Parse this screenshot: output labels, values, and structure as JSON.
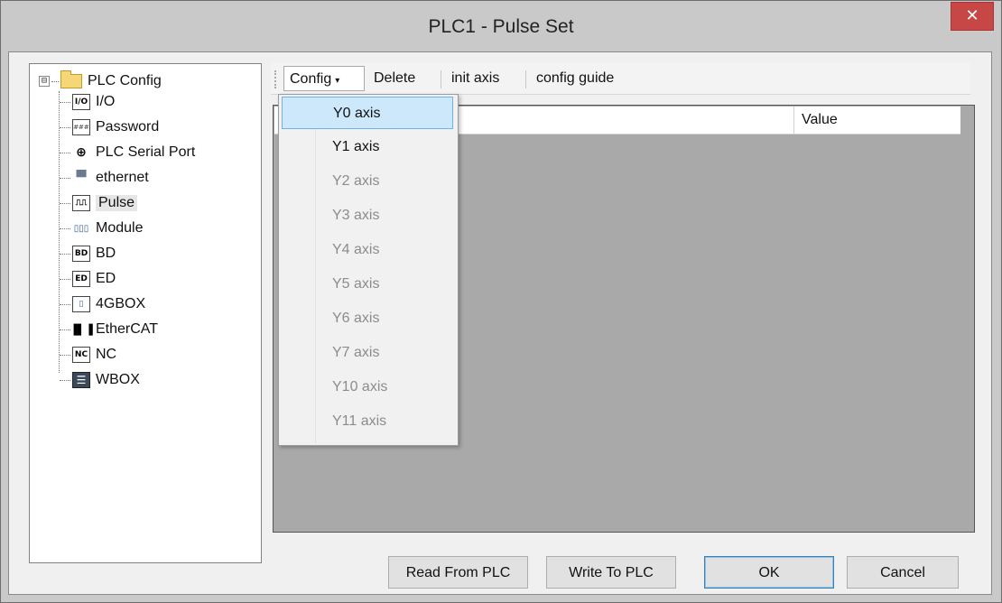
{
  "window": {
    "title": "PLC1 - Pulse  Set",
    "close_glyph": "✕"
  },
  "tree": {
    "root": {
      "label": "PLC Config",
      "expander": "⊟",
      "icon": "folder-icon"
    },
    "items": [
      {
        "label": "I/O",
        "icon": "io-icon",
        "glyph": "I/O"
      },
      {
        "label": "Password",
        "icon": "password-icon",
        "glyph": "###"
      },
      {
        "label": "PLC Serial Port",
        "icon": "serial-port-icon",
        "glyph": "⊕"
      },
      {
        "label": "ethernet",
        "icon": "ethernet-icon",
        "glyph": "▀"
      },
      {
        "label": "Pulse",
        "icon": "pulse-icon",
        "glyph": "⎍⎍",
        "selected": true
      },
      {
        "label": "Module",
        "icon": "module-icon",
        "glyph": "▯▯▯"
      },
      {
        "label": "BD",
        "icon": "bd-icon",
        "glyph": "BD"
      },
      {
        "label": "ED",
        "icon": "ed-icon",
        "glyph": "ED"
      },
      {
        "label": "4GBOX",
        "icon": "4gbox-icon",
        "glyph": "▯"
      },
      {
        "label": "EtherCAT",
        "icon": "ethercat-icon",
        "glyph": "▐▌▐"
      },
      {
        "label": "NC",
        "icon": "nc-icon",
        "glyph": "NC"
      },
      {
        "label": "WBOX",
        "icon": "wbox-icon",
        "glyph": "☰"
      }
    ]
  },
  "toolbar": {
    "config": "Config",
    "config_caret": "▾",
    "delete": "Delete",
    "init_axis": "init axis",
    "config_guide": "config guide"
  },
  "grid": {
    "columns": [
      "",
      "Value"
    ]
  },
  "dropdown": {
    "items": [
      {
        "label": "Y0 axis",
        "enabled": true,
        "highlighted": true
      },
      {
        "label": "Y1 axis",
        "enabled": true
      },
      {
        "label": "Y2 axis",
        "enabled": false
      },
      {
        "label": "Y3 axis",
        "enabled": false
      },
      {
        "label": "Y4 axis",
        "enabled": false
      },
      {
        "label": "Y5 axis",
        "enabled": false
      },
      {
        "label": "Y6 axis",
        "enabled": false
      },
      {
        "label": "Y7 axis",
        "enabled": false
      },
      {
        "label": "Y10 axis",
        "enabled": false
      },
      {
        "label": "Y11 axis",
        "enabled": false
      }
    ]
  },
  "buttons": {
    "read": "Read From PLC",
    "write": "Write To PLC",
    "ok": "OK",
    "cancel": "Cancel"
  },
  "colors": {
    "close_button": "#c74747",
    "menu_highlight": "#cde8fb",
    "grid_background": "#a9a9a9"
  }
}
